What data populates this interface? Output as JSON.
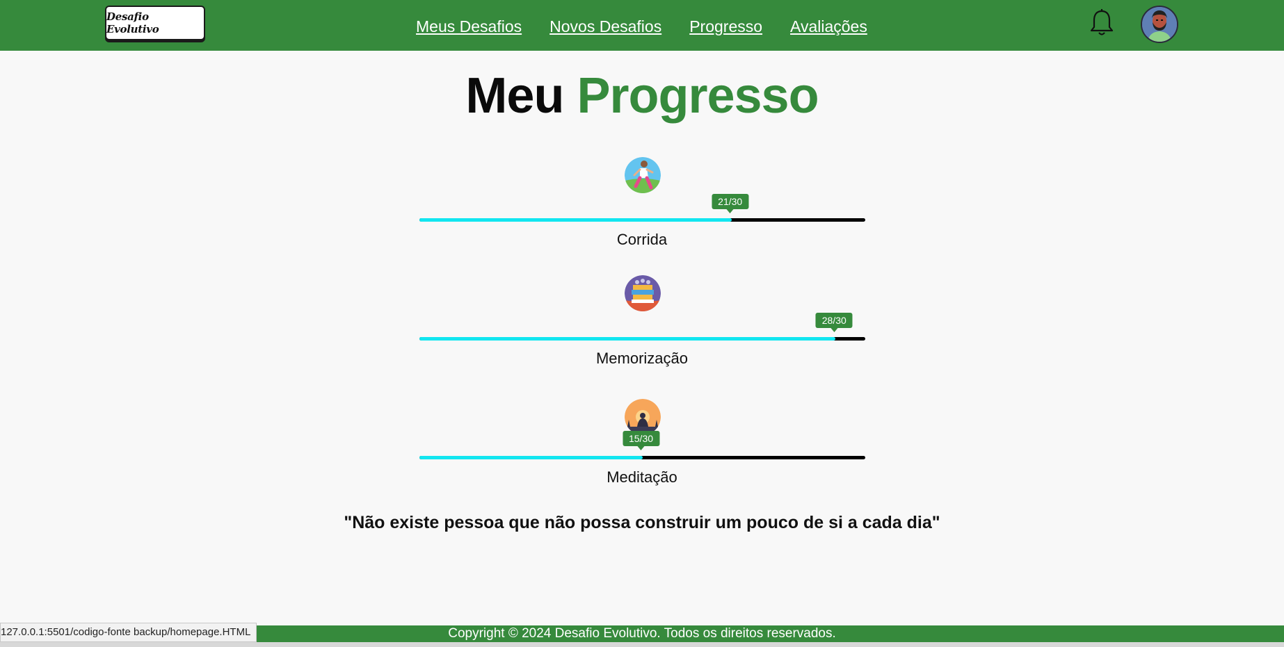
{
  "header": {
    "logo_text": "Desafio Evolutivo",
    "nav": [
      "Meus Desafios",
      "Novos Desafios",
      "Progresso",
      "Avaliações"
    ],
    "icons": {
      "notification": "bell-icon",
      "profile": "avatar"
    }
  },
  "title": {
    "part1": "Meu",
    "part2": "Progresso"
  },
  "activities": [
    {
      "name": "Corrida",
      "progress_label": "21/30",
      "done": 21,
      "total": 30,
      "icon": "runner-icon"
    },
    {
      "name": "Memorização",
      "progress_label": "28/30",
      "done": 28,
      "total": 30,
      "icon": "books-icon"
    },
    {
      "name": "Meditação",
      "progress_label": "15/30",
      "done": 15,
      "total": 30,
      "icon": "meditation-icon"
    }
  ],
  "quote": "\"Não existe pessoa que não possa construir um pouco de si a cada dia\"",
  "footer": "Copyright © 2024 Desafio Evolutivo. Todos os direitos reservados.",
  "status_url": "127.0.0.1:5501/codigo-fonte backup/homepage.HTML",
  "colors": {
    "brand_green": "#368a3c",
    "progress_fill": "#12e6f0",
    "progress_track": "#000000"
  }
}
